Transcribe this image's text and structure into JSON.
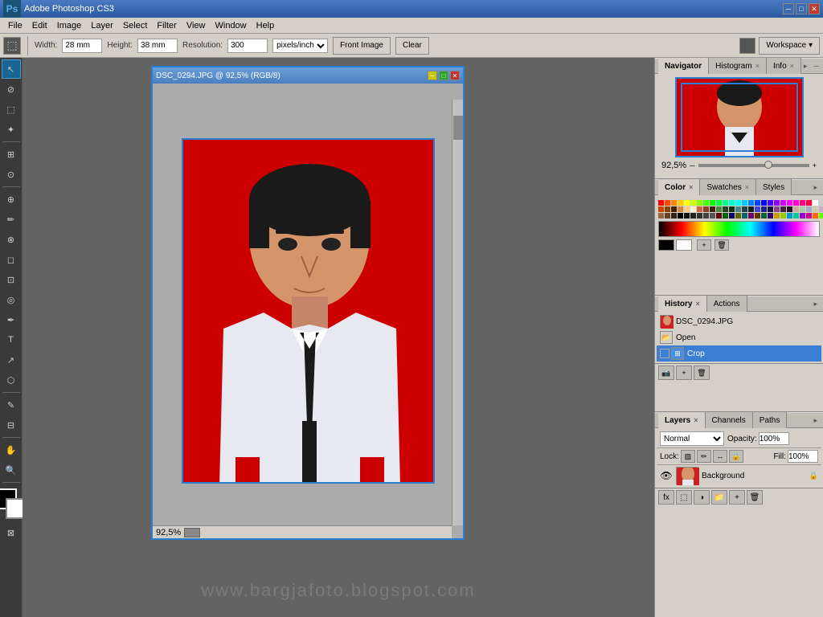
{
  "app": {
    "title": "Adobe Photoshop CS3",
    "logo": "Ps"
  },
  "title_bar": {
    "title": "Adobe Photoshop CS3",
    "min_btn": "─",
    "max_btn": "□",
    "close_btn": "✕"
  },
  "menu": {
    "items": [
      "File",
      "Edit",
      "Image",
      "Layer",
      "Select",
      "Filter",
      "View",
      "Window",
      "Help"
    ]
  },
  "options_bar": {
    "width_label": "Width:",
    "width_value": "28 mm",
    "height_label": "Height:",
    "height_value": "38 mm",
    "resolution_label": "Resolution:",
    "resolution_value": "300",
    "resolution_unit": "pixels/inch",
    "front_image_btn": "Front Image",
    "clear_btn": "Clear",
    "workspace_btn": "Workspace ▾"
  },
  "document": {
    "title": "DSC_0294.JPG @ 92,5% (RGB/8)",
    "zoom": "92,5%"
  },
  "navigator": {
    "tab_label": "Navigator",
    "histogram_label": "Histogram",
    "info_label": "Info",
    "zoom_pct": "92,5%"
  },
  "color_panel": {
    "color_tab": "Color",
    "swatches_tab": "Swatches",
    "styles_tab": "Styles"
  },
  "history_panel": {
    "history_tab": "History",
    "actions_tab": "Actions",
    "items": [
      {
        "label": "DSC_0294.JPG",
        "type": "thumb"
      },
      {
        "label": "Open",
        "type": "icon"
      },
      {
        "label": "Crop",
        "type": "icon",
        "active": true
      }
    ]
  },
  "layers_panel": {
    "layers_tab": "Layers",
    "channels_tab": "Channels",
    "paths_tab": "Paths",
    "blend_mode": "Normal",
    "opacity_label": "Opacity:",
    "opacity_value": "100%",
    "fill_label": "Fill:",
    "fill_value": "100%",
    "lock_label": "Lock:",
    "layer_name": "Background"
  },
  "tools": [
    "↖",
    "✂",
    "⬚",
    "⊗",
    "↗",
    "✏",
    "⌂",
    "⊕",
    "⊘",
    "⎆",
    "T",
    "✦",
    "◎",
    "⊙",
    "⬡",
    "⊞",
    "⊡",
    "⊟",
    "⊠"
  ],
  "watermark": "www.bargjafoto.blogspot.com",
  "swatches": {
    "colors": [
      "#ff0000",
      "#ff4400",
      "#ff8800",
      "#ffcc00",
      "#ffff00",
      "#ccff00",
      "#88ff00",
      "#44ff00",
      "#00ff00",
      "#00ff44",
      "#00ff88",
      "#00ffcc",
      "#00ffff",
      "#00ccff",
      "#0088ff",
      "#0044ff",
      "#0000ff",
      "#4400ff",
      "#8800ff",
      "#cc00ff",
      "#ff00ff",
      "#ff00cc",
      "#ff0088",
      "#ff0044",
      "#ffffff",
      "#cccccc",
      "#888888",
      "#cc4400",
      "#884400",
      "#442200",
      "#cc8844",
      "#ffcc88",
      "#ffeecc",
      "#cc6644",
      "#884422",
      "#442211",
      "#448844",
      "#224422",
      "#113311",
      "#448888",
      "#224444",
      "#112222",
      "#4444cc",
      "#222288",
      "#111144",
      "#884488",
      "#442244",
      "#221122",
      "#ccaaaa",
      "#aaccaa",
      "#aaaacc",
      "#ccccaa",
      "#ccaacc",
      "#aacccc",
      "#996644",
      "#664422",
      "#332211",
      "#000000",
      "#111111",
      "#222222",
      "#333333",
      "#444444",
      "#555555",
      "#660000",
      "#006600",
      "#000066",
      "#666600",
      "#006666",
      "#660066",
      "#663300",
      "#006633",
      "#330066",
      "#cc9900",
      "#99cc00",
      "#0099cc",
      "#00cc99",
      "#9900cc",
      "#cc0099",
      "#ff6600",
      "#66ff00",
      "#0066ff"
    ]
  }
}
